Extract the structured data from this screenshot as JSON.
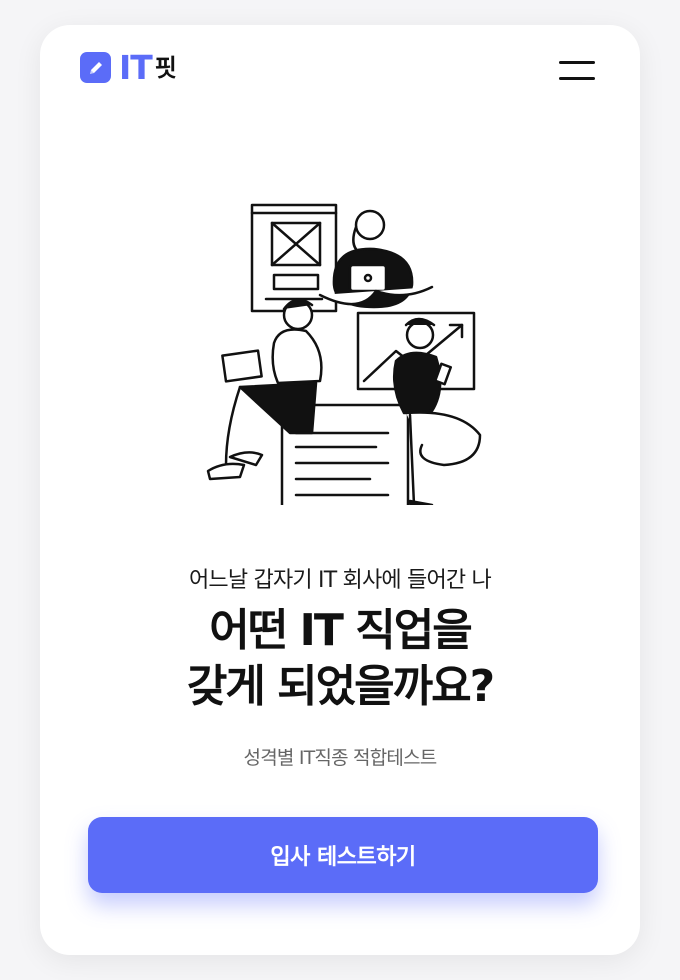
{
  "logo": {
    "brand_latin": "IT",
    "brand_korean": "핏",
    "icon": "pencil-icon"
  },
  "header": {
    "menu_icon": "hamburger-menu-icon"
  },
  "hero": {
    "subtitle": "어느날 갑자기 IT 회사에 들어간 나",
    "title_line1": "어떤 IT 직업을",
    "title_line2": "갖게 되었을까요?",
    "tagline": "성격별 IT직종 적합테스트"
  },
  "cta": {
    "label": "입사 테스트하기"
  },
  "colors": {
    "accent": "#5b6cf8",
    "text": "#111111",
    "muted": "#666666"
  }
}
